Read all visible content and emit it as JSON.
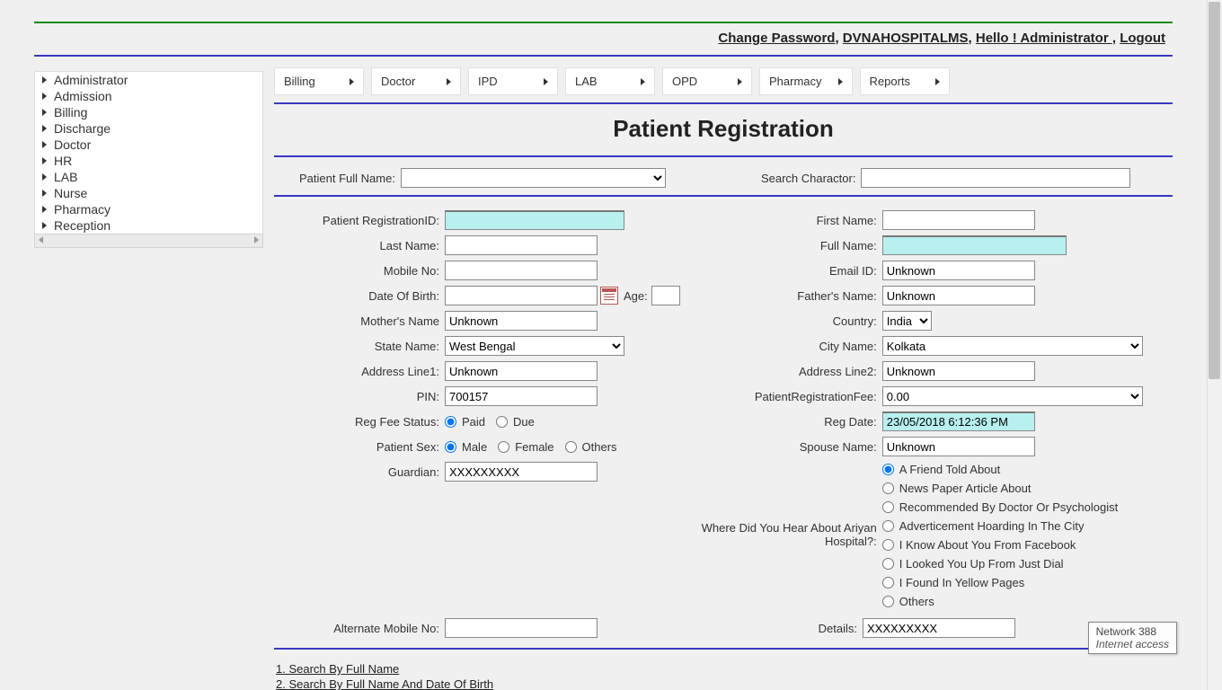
{
  "header": {
    "change_password": "Change Password",
    "site_name": "DVNAHOSPITALMS",
    "greeting": "Hello ! Administrator ",
    "logout": "Logout"
  },
  "sidebar": {
    "items": [
      "Administrator",
      "Admission",
      "Billing",
      "Discharge",
      "Doctor",
      "HR",
      "LAB",
      "Nurse",
      "Pharmacy",
      "Reception"
    ]
  },
  "topnav": {
    "items": [
      "Billing",
      "Doctor",
      "IPD",
      "LAB",
      "OPD",
      "Pharmacy",
      "Reports"
    ]
  },
  "page_title": "Patient Registration",
  "search": {
    "full_name_label": "Patient Full Name:",
    "char_label": "Search Charactor:"
  },
  "form": {
    "labels": {
      "reg_id": "Patient RegistrationID:",
      "first_name": "First Name:",
      "last_name": "Last Name:",
      "full_name": "Full Name:",
      "mobile": "Mobile No:",
      "email": "Email ID:",
      "dob": "Date Of Birth:",
      "age": "Age:",
      "father": "Father's Name:",
      "mother": "Mother's Name",
      "country": "Country:",
      "state": "State Name:",
      "city": "City Name:",
      "addr1": "Address Line1:",
      "addr2": "Address Line2:",
      "pin": "PIN:",
      "reg_fee": "PatientRegistrationFee:",
      "fee_status": "Reg Fee Status:",
      "reg_date": "Reg Date:",
      "sex": "Patient Sex:",
      "spouse": "Spouse Name:",
      "guardian": "Guardian:",
      "hear": "Where Did You Hear About Ariyan Hospital?:",
      "alt_mobile": "Alternate Mobile No:",
      "details": "Details:"
    },
    "values": {
      "email": "Unknown",
      "father": "Unknown",
      "mother": "Unknown",
      "country": "India",
      "state": "West Bengal",
      "city": "Kolkata",
      "addr1": "Unknown",
      "addr2": "Unknown",
      "pin": "700157",
      "reg_fee": "0.00",
      "reg_date": "23/05/2018 6:12:36 PM",
      "spouse": "Unknown",
      "guardian": "XXXXXXXXX",
      "details": "XXXXXXXXX"
    },
    "fee_status_opts": {
      "paid": "Paid",
      "due": "Due"
    },
    "sex_opts": {
      "male": "Male",
      "female": "Female",
      "others": "Others"
    },
    "hear_opts": [
      "A Friend Told About",
      "News Paper Article About",
      "Recommended By Doctor Or Psychologist",
      "Adverticement Hoarding In The City",
      "I Know About You From Facebook",
      "I Looked You Up From Just Dial",
      "I Found In Yellow Pages",
      "Others"
    ]
  },
  "footer": {
    "s1": "1. Search By Full Name",
    "s2": "2. Search By Full Name And Date Of Birth"
  },
  "tooltip": {
    "l1": "Network  388",
    "l2": "Internet access"
  }
}
